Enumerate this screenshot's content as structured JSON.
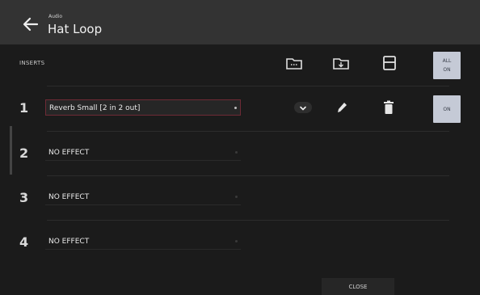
{
  "header": {
    "subtitle": "Audio",
    "title": "Hat Loop"
  },
  "inserts": {
    "label": "INSERTS",
    "all_on_line1": "ALL",
    "all_on_line2": "ON",
    "on_label": "ON",
    "slots": [
      {
        "number": "1",
        "name": "Reverb Small [2 in 2 out]"
      },
      {
        "number": "2",
        "name": "NO EFFECT"
      },
      {
        "number": "3",
        "name": "NO EFFECT"
      },
      {
        "number": "4",
        "name": "NO EFFECT"
      }
    ]
  },
  "footer": {
    "close_label": "CLOSE"
  },
  "colors": {
    "header_bg": "#333333",
    "accent_border": "#6e2a35",
    "on_button": "#c5cad6"
  }
}
